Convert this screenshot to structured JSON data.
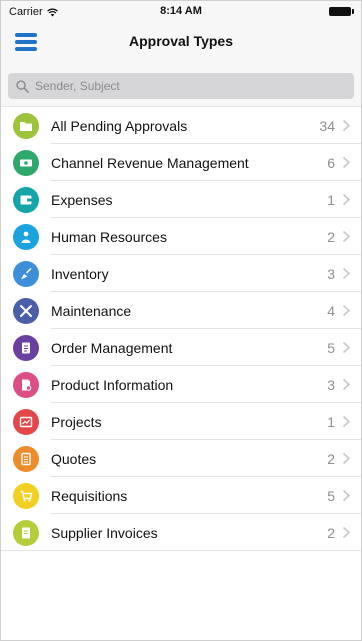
{
  "status": {
    "carrier": "Carrier",
    "time": "8:14 AM"
  },
  "nav": {
    "title": "Approval Types",
    "menu_icon": "hamburger-menu-icon"
  },
  "search": {
    "placeholder": "Sender, Subject",
    "icon": "search-icon"
  },
  "items": [
    {
      "label": "All Pending Approvals",
      "count": "34",
      "color": "#9bc43a",
      "icon": "folder-icon"
    },
    {
      "label": "Channel Revenue Management",
      "count": "6",
      "color": "#2fa86b",
      "icon": "money-icon"
    },
    {
      "label": "Expenses",
      "count": "1",
      "color": "#15a5a8",
      "icon": "wallet-icon"
    },
    {
      "label": "Human Resources",
      "count": "2",
      "color": "#1aa3df",
      "icon": "person-icon"
    },
    {
      "label": "Inventory",
      "count": "3",
      "color": "#3c8fd8",
      "icon": "broom-icon"
    },
    {
      "label": "Maintenance",
      "count": "4",
      "color": "#4b5fa8",
      "icon": "tools-icon"
    },
    {
      "label": "Order Management",
      "count": "5",
      "color": "#6a3f9f",
      "icon": "document-icon"
    },
    {
      "label": "Product Information",
      "count": "3",
      "color": "#dc4f86",
      "icon": "product-doc-icon"
    },
    {
      "label": "Projects",
      "count": "1",
      "color": "#e4474a",
      "icon": "projects-icon"
    },
    {
      "label": "Quotes",
      "count": "2",
      "color": "#ec8c2a",
      "icon": "quote-icon"
    },
    {
      "label": "Requisitions",
      "count": "5",
      "color": "#f3cf24",
      "icon": "cart-icon"
    },
    {
      "label": "Supplier Invoices",
      "count": "2",
      "color": "#b5cc3b",
      "icon": "invoice-icon"
    }
  ],
  "colors": {
    "accent": "#1f73c8",
    "count_text": "#8e8e93",
    "chevron": "#c7c7cc"
  }
}
